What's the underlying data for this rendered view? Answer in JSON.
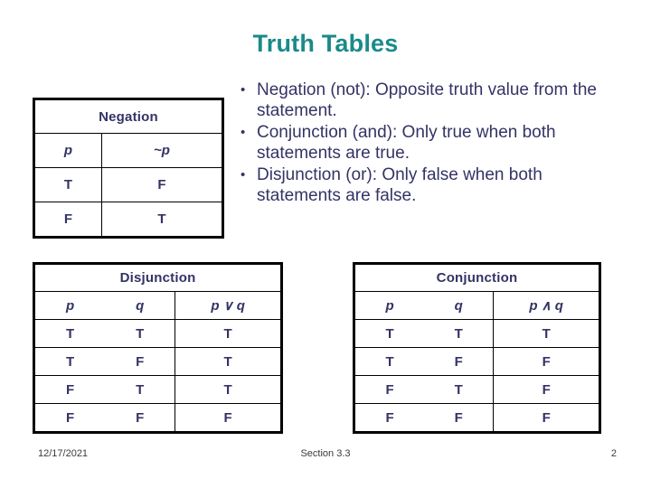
{
  "slide": {
    "title": "Truth Tables",
    "title_color": "#1a8a8a",
    "text_color": "#333366"
  },
  "negation_table": {
    "title": "Negation",
    "headers": [
      "p",
      "~p"
    ],
    "rows": [
      [
        "T",
        "F"
      ],
      [
        "F",
        "T"
      ]
    ]
  },
  "bullets": [
    {
      "marker": "•",
      "text": "Negation (not):  Opposite truth value from the statement."
    },
    {
      "marker": "•",
      "text": "Conjunction (and):  Only true when both statements are true."
    },
    {
      "marker": "•",
      "text": "Disjunction (or):  Only false when both statements are false."
    }
  ],
  "disjunction_table": {
    "title": "Disjunction",
    "headers": [
      "p",
      "q",
      "p ∨ q"
    ],
    "rows": [
      [
        "T",
        "T",
        "T"
      ],
      [
        "T",
        "F",
        "T"
      ],
      [
        "F",
        "T",
        "T"
      ],
      [
        "F",
        "F",
        "F"
      ]
    ]
  },
  "conjunction_table": {
    "title": "Conjunction",
    "headers": [
      "p",
      "q",
      "p ∧ q"
    ],
    "rows": [
      [
        "T",
        "T",
        "T"
      ],
      [
        "T",
        "F",
        "F"
      ],
      [
        "F",
        "T",
        "F"
      ],
      [
        "F",
        "F",
        "F"
      ]
    ]
  },
  "footer": {
    "date": "12/17/2021",
    "section": "Section 3.3",
    "page": "2"
  }
}
